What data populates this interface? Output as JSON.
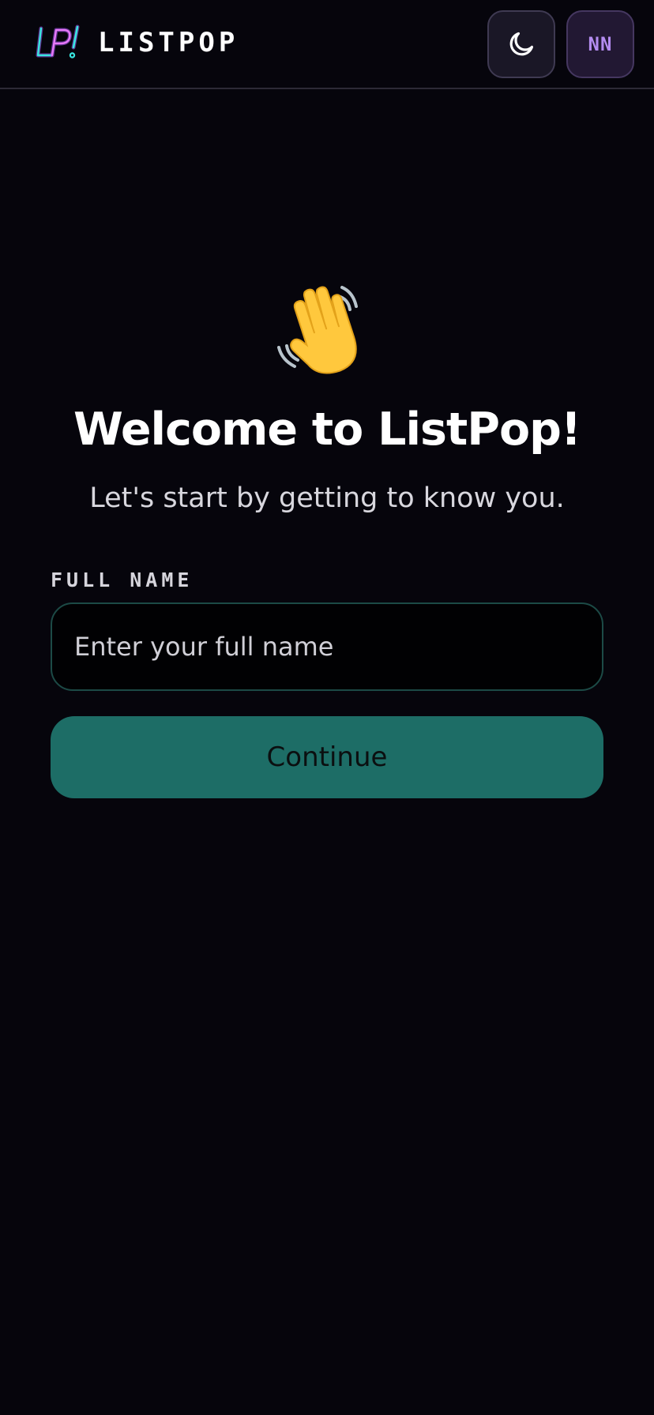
{
  "header": {
    "brand": "LISTPOP",
    "logo_icon": "lp-neon-logo-icon",
    "theme_toggle_icon": "moon-icon",
    "avatar_initials": "NN"
  },
  "main": {
    "emoji_icon": "waving-hand-icon",
    "title": "Welcome to ListPop!",
    "subtitle": "Let's start by getting to know you.",
    "field_label": "FULL NAME",
    "name_placeholder": "Enter your full name",
    "name_value": "",
    "continue_label": "Continue"
  },
  "colors": {
    "background": "#06050c",
    "accent": "#1d6d66",
    "avatar_text": "#b48cf0"
  }
}
